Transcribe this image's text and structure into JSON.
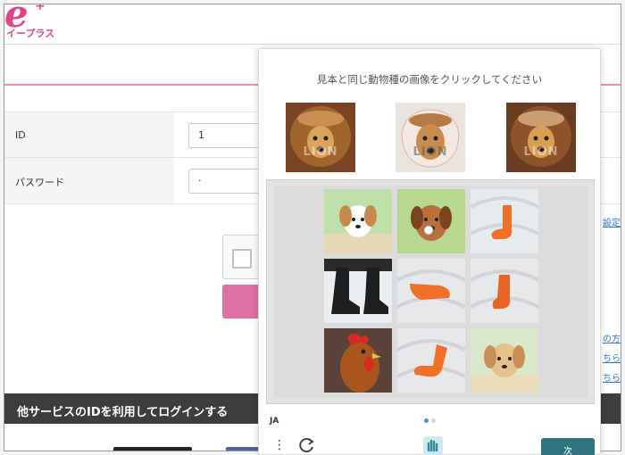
{
  "header": {
    "logo_mark": "e",
    "logo_plus": "+",
    "logo_text": "イープラス"
  },
  "form": {
    "id_label": "ID",
    "id_value": "1",
    "password_label": "パスワード",
    "password_value": "·"
  },
  "right_links": {
    "settings": "設定",
    "first_time": "の方",
    "here_1": "ちら",
    "here_2": "ちら"
  },
  "other_services": {
    "banner": "他サービスのIDを利用してログインする"
  },
  "captcha": {
    "prompt": "見本と同じ動物種の画像をクリックしてください",
    "samples": [
      {
        "watermark": "LION",
        "icon": "lion-dog-sample"
      },
      {
        "watermark": "LION",
        "icon": "lion-dog-sample"
      },
      {
        "watermark": "LION",
        "icon": "lion-dog-sample"
      }
    ],
    "tiles": [
      {
        "subject": "puppy"
      },
      {
        "subject": "puppy"
      },
      {
        "subject": "sock"
      },
      {
        "subject": "boots"
      },
      {
        "subject": "sock"
      },
      {
        "subject": "sock"
      },
      {
        "subject": "rooster"
      },
      {
        "subject": "sock"
      },
      {
        "subject": "puppy"
      }
    ],
    "language": "JA",
    "next_label": "次"
  },
  "colors": {
    "brand_pink": "#e0448a",
    "captcha_button": "#2f7480"
  }
}
